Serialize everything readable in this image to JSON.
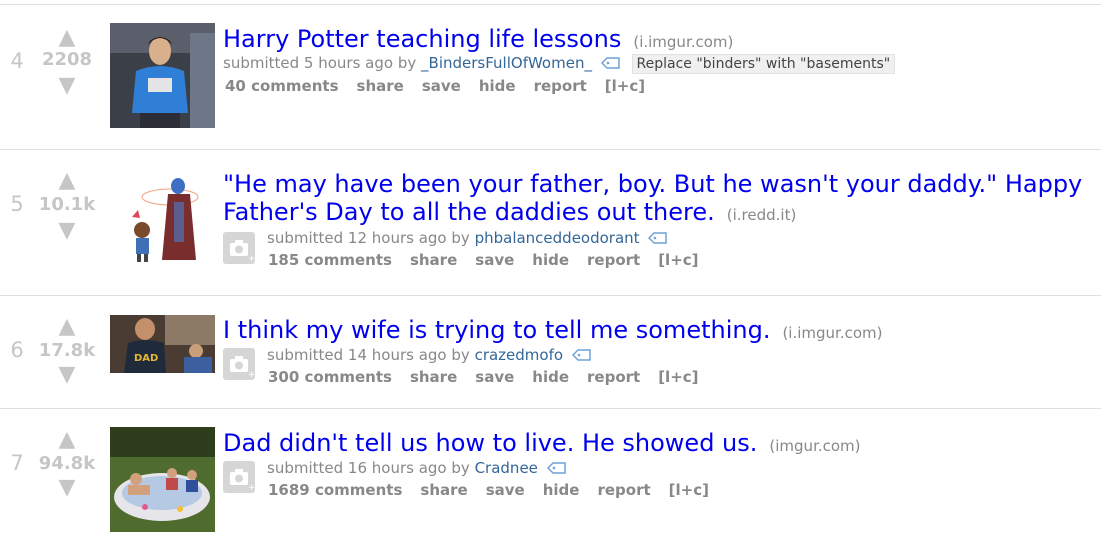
{
  "posts": [
    {
      "rank": "4",
      "score": "2208",
      "title": "Harry Potter teaching life lessons",
      "domain": "(i.imgur.com)",
      "submitted_prefix": "submitted",
      "time": "5 hours ago",
      "by": "by",
      "author": "_BindersFullOfWomen_",
      "flair": "Replace \"binders\" with \"basements\"",
      "buttons": {
        "comments": "40 comments",
        "share": "share",
        "save": "save",
        "hide": "hide",
        "report": "report",
        "expand": "[l+c]"
      }
    },
    {
      "rank": "5",
      "score": "10.1k",
      "title_line1": "\"He may have been your father, boy. But he wasn't your daddy.\" Happy",
      "title_line2": "Father's Day to all the daddies out there.",
      "domain": "(i.redd.it)",
      "submitted_prefix": "submitted",
      "time": "12 hours ago",
      "by": "by",
      "author": "phbalanceddeodorant",
      "buttons": {
        "comments": "185 comments",
        "share": "share",
        "save": "save",
        "hide": "hide",
        "report": "report",
        "expand": "[l+c]"
      }
    },
    {
      "rank": "6",
      "score": "17.8k",
      "title": "I think my wife is trying to tell me something.",
      "domain": "(i.imgur.com)",
      "submitted_prefix": "submitted",
      "time": "14 hours ago",
      "by": "by",
      "author": "crazedmofo",
      "buttons": {
        "comments": "300 comments",
        "share": "share",
        "save": "save",
        "hide": "hide",
        "report": "report",
        "expand": "[l+c]"
      }
    },
    {
      "rank": "7",
      "score": "94.8k",
      "title": "Dad didn't tell us how to live. He showed us.",
      "domain": "(imgur.com)",
      "submitted_prefix": "submitted",
      "time": "16 hours ago",
      "by": "by",
      "author": "Cradnee",
      "buttons": {
        "comments": "1689 comments",
        "share": "share",
        "save": "save",
        "hide": "hide",
        "report": "report",
        "expand": "[l+c]"
      }
    }
  ]
}
